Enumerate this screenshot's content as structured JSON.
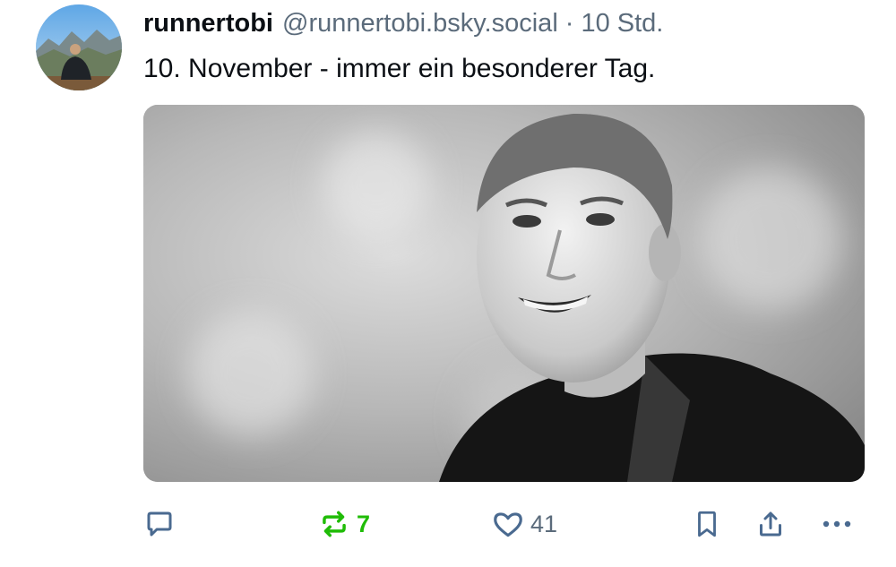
{
  "post": {
    "author": {
      "display_name": "runnertobi",
      "handle": "@runnertobi.bsky.social",
      "separator": "·",
      "time_ago": "10 Std."
    },
    "text": "10. November - immer ein besonderer Tag.",
    "media": {
      "type": "image",
      "style": "black-and-white portrait photo"
    }
  },
  "actions": {
    "reply": {
      "icon": "reply-icon"
    },
    "repost": {
      "icon": "repost-icon",
      "count": "7",
      "active": true,
      "color": "#20bc07"
    },
    "like": {
      "icon": "heart-icon",
      "count": "41"
    },
    "bookmark": {
      "icon": "bookmark-icon"
    },
    "share": {
      "icon": "share-icon"
    },
    "more": {
      "icon": "more-icon"
    }
  },
  "colors": {
    "text_primary": "#0b0f14",
    "text_secondary": "#5b6b7b",
    "icon": "#4a6a90",
    "repost_active": "#20bc07"
  }
}
